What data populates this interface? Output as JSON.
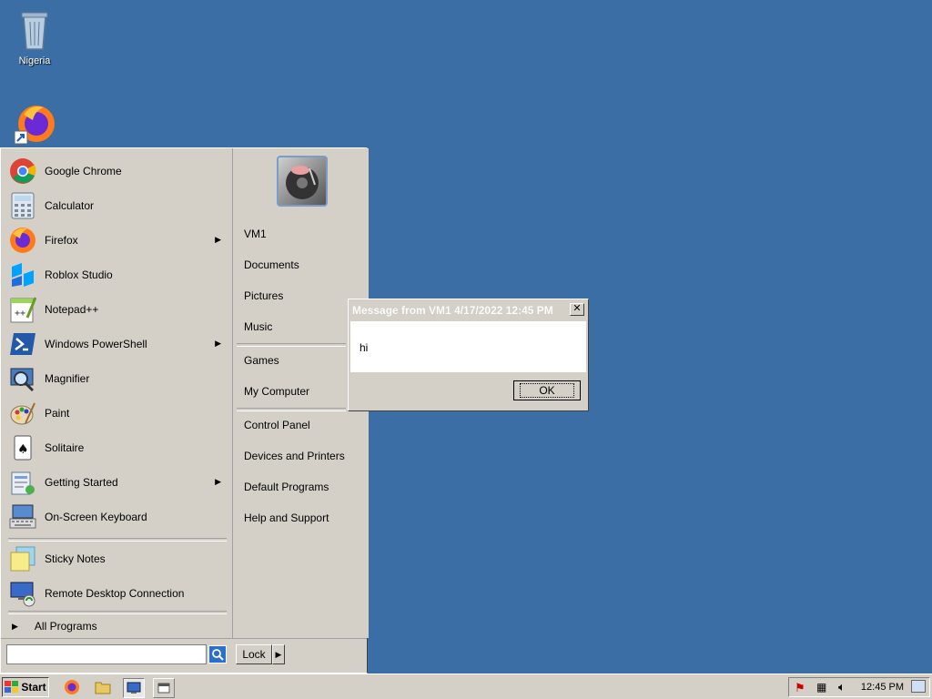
{
  "desktop": {
    "icons": [
      {
        "label": "Nigeria",
        "icon": "recycle-bin-icon"
      },
      {
        "label": "",
        "icon": "firefox-shortcut-icon"
      }
    ]
  },
  "start_menu": {
    "programs": [
      {
        "label": "Google Chrome",
        "icon": "chrome-icon",
        "submenu": false
      },
      {
        "label": "Calculator",
        "icon": "calculator-icon",
        "submenu": false
      },
      {
        "label": "Firefox",
        "icon": "firefox-icon",
        "submenu": true
      },
      {
        "label": "Roblox Studio",
        "icon": "roblox-studio-icon",
        "submenu": false
      },
      {
        "label": "Notepad++",
        "icon": "notepad-plus-plus-icon",
        "submenu": false
      },
      {
        "label": "Windows PowerShell",
        "icon": "powershell-icon",
        "submenu": true
      },
      {
        "label": "Magnifier",
        "icon": "magnifier-icon",
        "submenu": false
      },
      {
        "label": "Paint",
        "icon": "paint-icon",
        "submenu": false
      },
      {
        "label": "Solitaire",
        "icon": "solitaire-icon",
        "submenu": false
      },
      {
        "label": "Getting Started",
        "icon": "getting-started-icon",
        "submenu": true
      },
      {
        "label": "On-Screen Keyboard",
        "icon": "keyboard-icon",
        "submenu": false
      }
    ],
    "recent": [
      {
        "label": "Sticky Notes",
        "icon": "sticky-notes-icon"
      },
      {
        "label": "Remote Desktop Connection",
        "icon": "remote-desktop-icon"
      }
    ],
    "all_programs": "All Programs",
    "right_links": {
      "group1": [
        "VM1",
        "Documents",
        "Pictures",
        "Music"
      ],
      "group2": [
        "Games",
        "My Computer"
      ],
      "group3": [
        "Control Panel",
        "Devices and Printers",
        "Default Programs",
        "Help and Support"
      ]
    },
    "search_placeholder": "",
    "lock_label": "Lock"
  },
  "dialog": {
    "title": "Message from VM1 4/17/2022 12:45 PM",
    "message": "hi",
    "ok_label": "OK"
  },
  "taskbar": {
    "start_label": "Start",
    "clock": "12:45 PM"
  }
}
